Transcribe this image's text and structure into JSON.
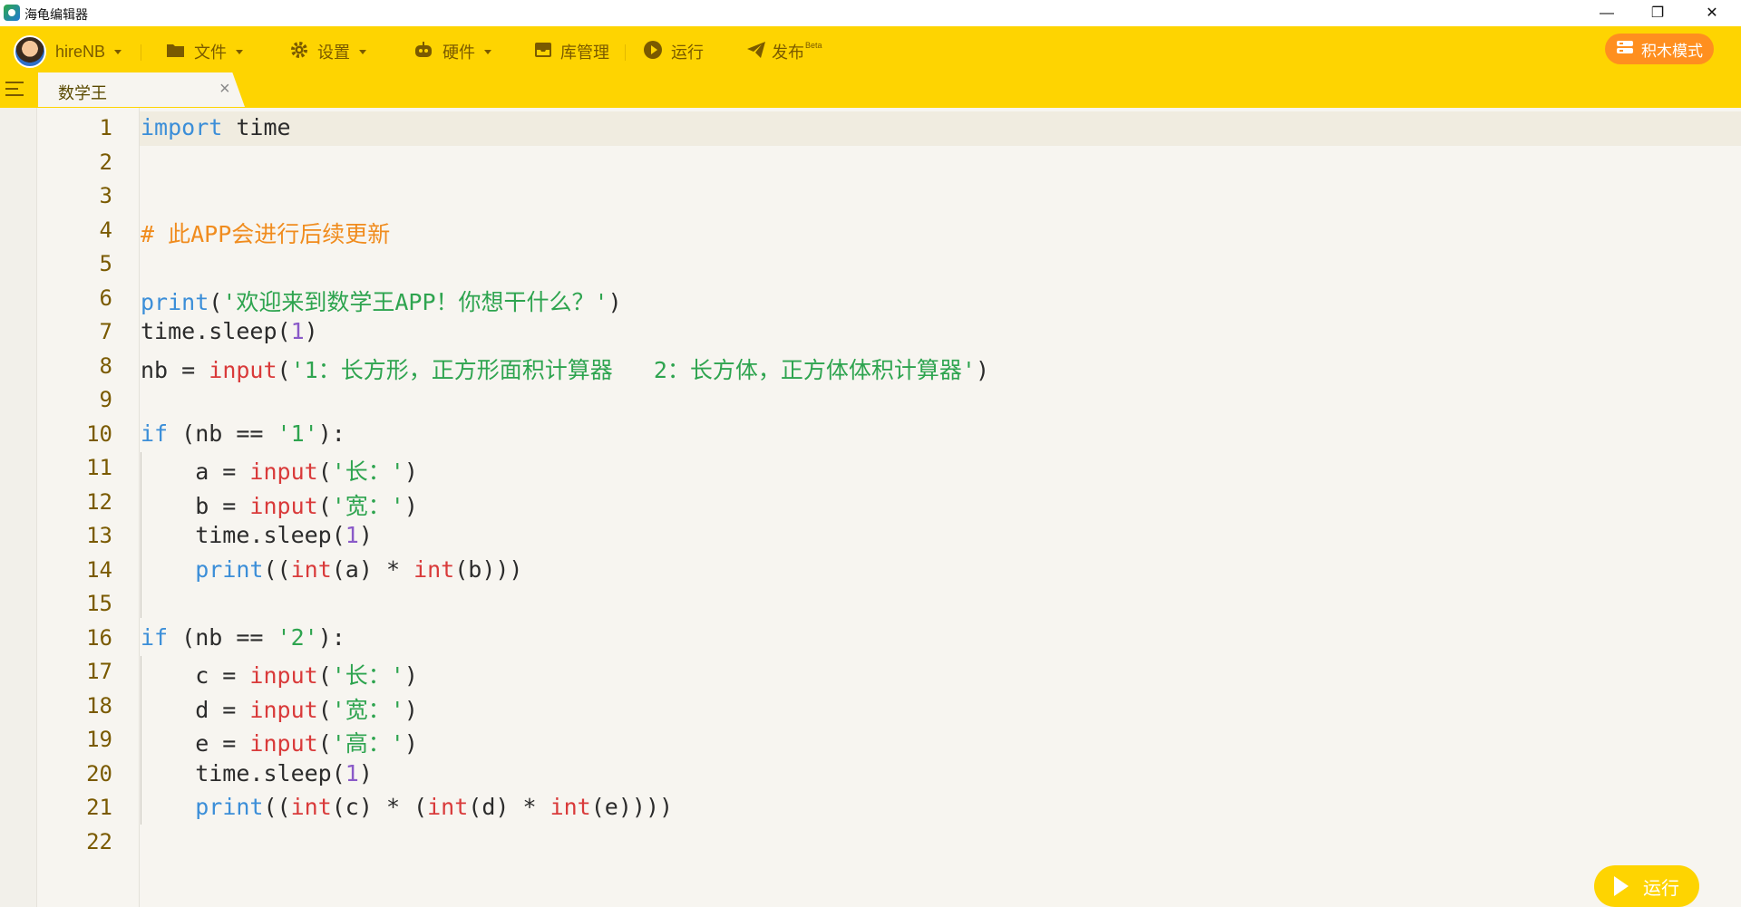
{
  "window": {
    "title": "海龟编辑器",
    "minimize": "—",
    "restore": "❐",
    "close": "✕"
  },
  "toolbar": {
    "user": "hireNB",
    "file": "文件",
    "settings": "设置",
    "hardware": "硬件",
    "library": "库管理",
    "run": "运行",
    "publish": "发布",
    "publish_badge": "Beta",
    "block_mode": "积木模式"
  },
  "tab": {
    "label": "数学王",
    "close": "×"
  },
  "editor": {
    "line_numbers": [
      "1",
      "2",
      "3",
      "4",
      "5",
      "6",
      "7",
      "8",
      "9",
      "10",
      "11",
      "12",
      "13",
      "14",
      "15",
      "16",
      "17",
      "18",
      "19",
      "20",
      "21",
      "22"
    ],
    "lines": [
      [
        {
          "t": "import",
          "c": "kw"
        },
        {
          "t": " time",
          "c": ""
        }
      ],
      [],
      [],
      [
        {
          "t": "# 此APP会进行后续更新",
          "c": "cm"
        }
      ],
      [],
      [
        {
          "t": "print",
          "c": "kw"
        },
        {
          "t": "(",
          "c": ""
        },
        {
          "t": "'欢迎来到数学王APP！你想干什么？'",
          "c": "str"
        },
        {
          "t": ")",
          "c": ""
        }
      ],
      [
        {
          "t": "time.sleep(",
          "c": ""
        },
        {
          "t": "1",
          "c": "num"
        },
        {
          "t": ")",
          "c": ""
        }
      ],
      [
        {
          "t": "nb = ",
          "c": ""
        },
        {
          "t": "input",
          "c": "fn"
        },
        {
          "t": "(",
          "c": ""
        },
        {
          "t": "'1：长方形，正方形面积计算器   2：长方体，正方体体积计算器'",
          "c": "str"
        },
        {
          "t": ")",
          "c": ""
        }
      ],
      [],
      [
        {
          "t": "if",
          "c": "kw"
        },
        {
          "t": " (nb == ",
          "c": ""
        },
        {
          "t": "'1'",
          "c": "str"
        },
        {
          "t": "):",
          "c": ""
        }
      ],
      [
        {
          "t": "    a = ",
          "c": ""
        },
        {
          "t": "input",
          "c": "fn"
        },
        {
          "t": "(",
          "c": ""
        },
        {
          "t": "'长：'",
          "c": "str"
        },
        {
          "t": ")",
          "c": ""
        }
      ],
      [
        {
          "t": "    b = ",
          "c": ""
        },
        {
          "t": "input",
          "c": "fn"
        },
        {
          "t": "(",
          "c": ""
        },
        {
          "t": "'宽：'",
          "c": "str"
        },
        {
          "t": ")",
          "c": ""
        }
      ],
      [
        {
          "t": "    time.sleep(",
          "c": ""
        },
        {
          "t": "1",
          "c": "num"
        },
        {
          "t": ")",
          "c": ""
        }
      ],
      [
        {
          "t": "    ",
          "c": ""
        },
        {
          "t": "print",
          "c": "kw"
        },
        {
          "t": "((",
          "c": ""
        },
        {
          "t": "int",
          "c": "fn"
        },
        {
          "t": "(a) * ",
          "c": ""
        },
        {
          "t": "int",
          "c": "fn"
        },
        {
          "t": "(b)))",
          "c": ""
        }
      ],
      [],
      [
        {
          "t": "if",
          "c": "kw"
        },
        {
          "t": " (nb == ",
          "c": ""
        },
        {
          "t": "'2'",
          "c": "str"
        },
        {
          "t": "):",
          "c": ""
        }
      ],
      [
        {
          "t": "    c = ",
          "c": ""
        },
        {
          "t": "input",
          "c": "fn"
        },
        {
          "t": "(",
          "c": ""
        },
        {
          "t": "'长：'",
          "c": "str"
        },
        {
          "t": ")",
          "c": ""
        }
      ],
      [
        {
          "t": "    d = ",
          "c": ""
        },
        {
          "t": "input",
          "c": "fn"
        },
        {
          "t": "(",
          "c": ""
        },
        {
          "t": "'宽：'",
          "c": "str"
        },
        {
          "t": ")",
          "c": ""
        }
      ],
      [
        {
          "t": "    e = ",
          "c": ""
        },
        {
          "t": "input",
          "c": "fn"
        },
        {
          "t": "(",
          "c": ""
        },
        {
          "t": "'高：'",
          "c": "str"
        },
        {
          "t": ")",
          "c": ""
        }
      ],
      [
        {
          "t": "    time.sleep(",
          "c": ""
        },
        {
          "t": "1",
          "c": "num"
        },
        {
          "t": ")",
          "c": ""
        }
      ],
      [
        {
          "t": "    ",
          "c": ""
        },
        {
          "t": "print",
          "c": "kw"
        },
        {
          "t": "((",
          "c": ""
        },
        {
          "t": "int",
          "c": "fn"
        },
        {
          "t": "(c) * (",
          "c": ""
        },
        {
          "t": "int",
          "c": "fn"
        },
        {
          "t": "(d) * ",
          "c": ""
        },
        {
          "t": "int",
          "c": "fn"
        },
        {
          "t": "(e))))",
          "c": ""
        }
      ],
      []
    ]
  },
  "run_button": {
    "label": "运行"
  }
}
